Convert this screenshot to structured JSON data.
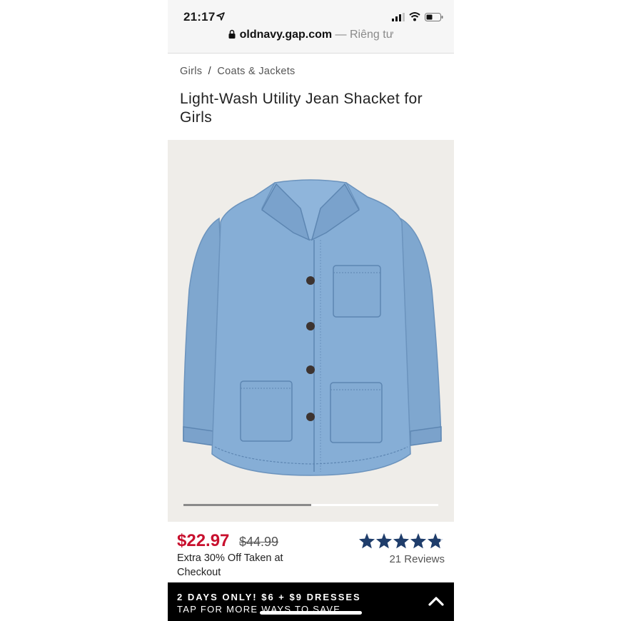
{
  "status_bar": {
    "time": "21:17",
    "icons": [
      "location-arrow-icon",
      "cellular-signal-icon",
      "wifi-icon",
      "battery-icon"
    ]
  },
  "address_bar": {
    "domain": "oldnavy.gap.com",
    "suffix": " — Riêng tư",
    "icon": "lock-icon"
  },
  "breadcrumb": {
    "items": [
      "Girls",
      "Coats & Jackets"
    ],
    "separator": "/"
  },
  "product": {
    "title": "Light-Wash Utility Jean Shacket for Girls",
    "image_carousel_progress": 0.5,
    "price_sale": "$22.97",
    "price_original": "$44.99",
    "promo_text": "Extra 30% Off Taken at Checkout",
    "rating_stars": 4.8,
    "reviews_label": "21 Reviews",
    "colors": {
      "sale_price": "#c8102e",
      "star": "#1f3d6b"
    }
  },
  "banner": {
    "line1": "2 DAYS ONLY! $6 + $9 DRESSES",
    "line2": "TAP FOR MORE WAYS TO SAVE",
    "icon": "chevron-up-icon"
  }
}
